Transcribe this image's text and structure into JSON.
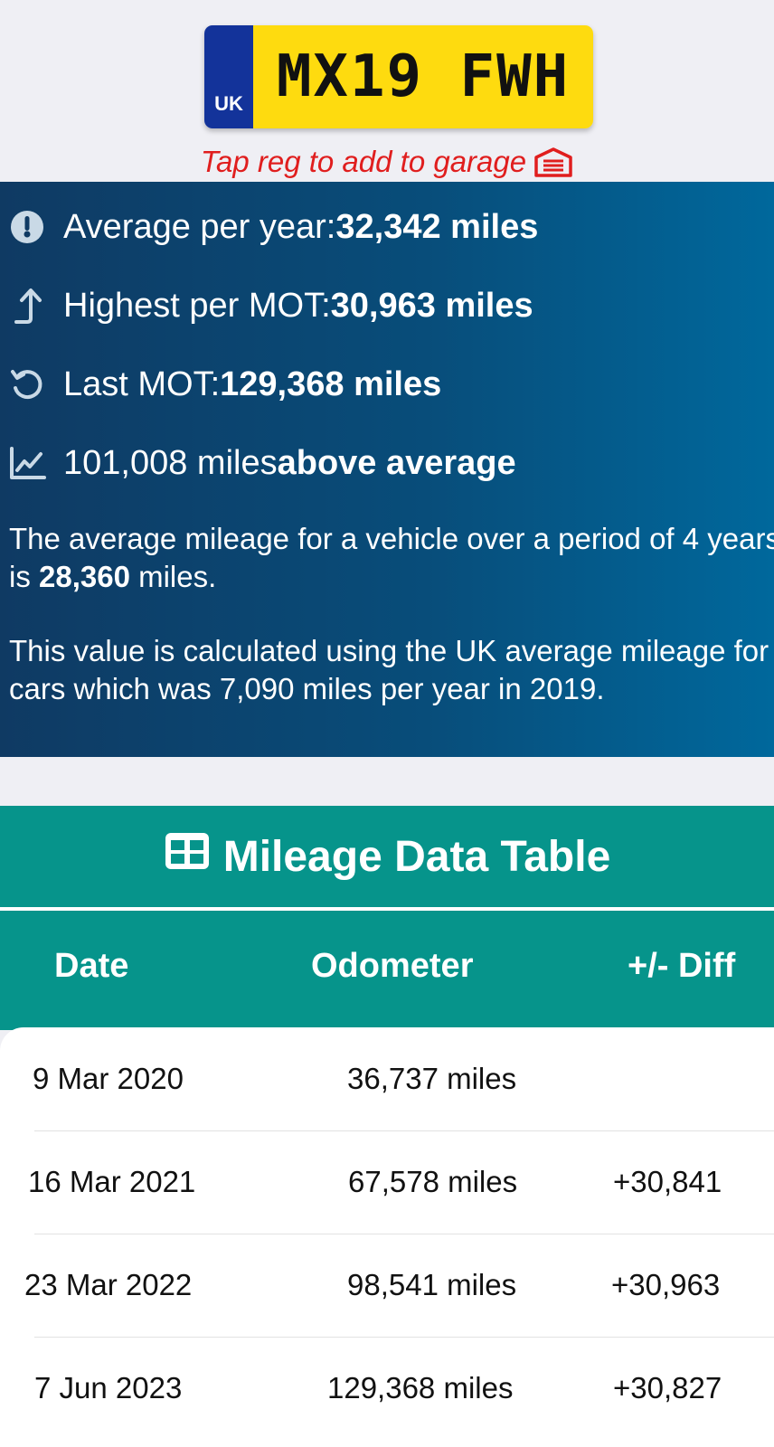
{
  "plate": {
    "country": "UK",
    "registration": "MX19 FWH"
  },
  "garage_hint": "Tap reg to add to garage",
  "stats": {
    "average_per_year": {
      "label": "Average per year: ",
      "value": "32,342 miles"
    },
    "highest_per_mot": {
      "label": "Highest per MOT: ",
      "value": "30,963 miles"
    },
    "last_mot": {
      "label": "Last MOT: ",
      "value": "129,368 miles"
    },
    "above_average": {
      "value": "101,008 miles",
      "label": " above average"
    },
    "para1": {
      "pre": "The average mileage for a vehicle over a period of 4 years is ",
      "value": "28,360",
      "post": " miles."
    },
    "para2": "This value is calculated using the UK average mileage for cars which was 7,090 miles per year in 2019."
  },
  "table": {
    "title": "Mileage Data Table",
    "columns": [
      "Date",
      "Odometer",
      "+/- Diff"
    ],
    "rows": [
      {
        "date": "9 Mar 2020",
        "odometer": "36,737 miles",
        "diff": ""
      },
      {
        "date": "16 Mar 2021",
        "odometer": "67,578 miles",
        "diff": "+30,841"
      },
      {
        "date": "23 Mar 2022",
        "odometer": "98,541 miles",
        "diff": "+30,963"
      },
      {
        "date": "7 Jun 2023",
        "odometer": "129,368 miles",
        "diff": "+30,827"
      }
    ]
  },
  "colors": {
    "plate_yellow": "#fedb0f",
    "plate_blue": "#13339a",
    "hint_red": "#e01e1e",
    "teal": "#06948b",
    "stats_gradient_start": "#0f3a63",
    "stats_gradient_end": "#00689c"
  }
}
